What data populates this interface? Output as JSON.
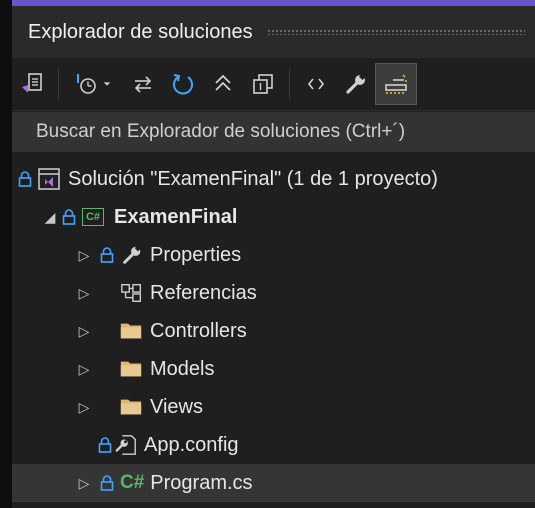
{
  "window": {
    "title": "Explorador de soluciones"
  },
  "search": {
    "placeholder": "Buscar en Explorador de soluciones (Ctrl+´)"
  },
  "tree": {
    "solution": {
      "label": "Solución \"ExamenFinal\"  (1 de 1 proyecto)"
    },
    "project": {
      "label": "ExamenFinal"
    },
    "items": [
      {
        "label": "Properties",
        "icon": "wrench-icon"
      },
      {
        "label": "Referencias",
        "icon": "references-icon"
      },
      {
        "label": "Controllers",
        "icon": "folder-icon"
      },
      {
        "label": "Models",
        "icon": "folder-icon"
      },
      {
        "label": "Views",
        "icon": "folder-icon"
      },
      {
        "label": "App.config",
        "icon": "config-file-icon"
      },
      {
        "label": "Program.cs",
        "icon": "csharp-file-icon"
      }
    ],
    "csharp_badge": "C#"
  },
  "colors": {
    "accent": "#6b55c8",
    "folder": "#dcb67a",
    "csharp": "#57b86a",
    "text": "#e6e6e6",
    "blue_icon": "#3ea6ff"
  }
}
